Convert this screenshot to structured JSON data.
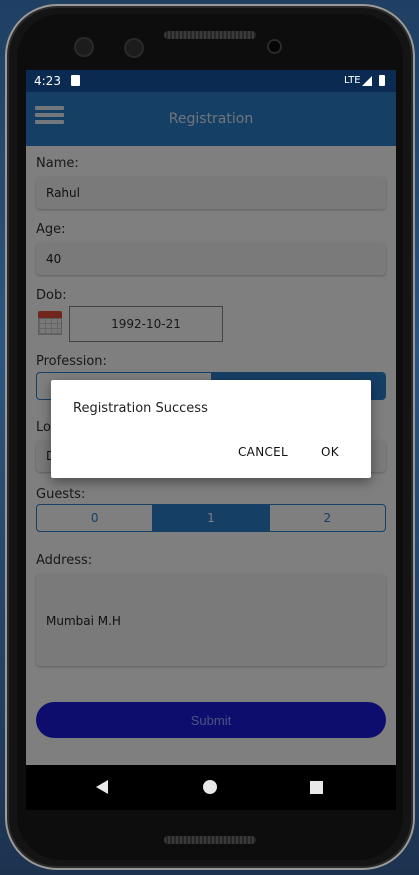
{
  "status_bar": {
    "time": "4:23",
    "network": "LTE"
  },
  "app_bar": {
    "title": "Registration"
  },
  "form": {
    "name_label": "Name:",
    "name_value": "Rahul",
    "age_label": "Age:",
    "age_value": "40",
    "dob_label": "Dob:",
    "dob_value": "1992-10-21",
    "profession_label": "Profession:",
    "location_label_visible": "Lo",
    "location_value_visible": "D",
    "guests_label": "Guests:",
    "guests_options": [
      "0",
      "1",
      "2"
    ],
    "guests_selected": "1",
    "address_label": "Address:",
    "address_value": "Mumbai M.H",
    "submit_label": "Submit"
  },
  "dialog": {
    "message": "Registration Success",
    "cancel_label": "CANCEL",
    "ok_label": "OK"
  },
  "colors": {
    "app_bar": "#2c7fcd",
    "accent": "#2c7fcd",
    "submit": "#1a1adb",
    "status_bar": "#0b2a52"
  },
  "icons": [
    "menu-icon",
    "calendar-icon",
    "back-icon",
    "home-icon",
    "recents-icon"
  ]
}
